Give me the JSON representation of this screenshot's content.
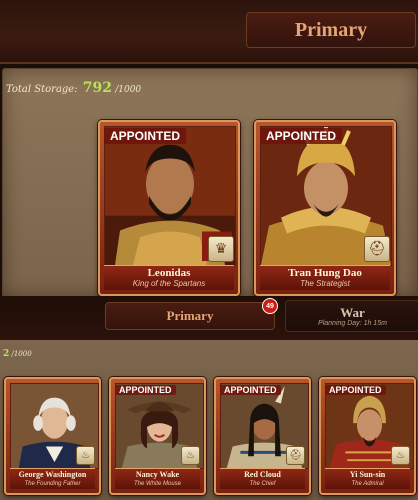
{
  "header": {
    "tab_primary": "Primary"
  },
  "storage": {
    "label": "Total Storage:",
    "current": "792",
    "max": "/1000"
  },
  "appointed_label": "APPOINTED",
  "top_generals": [
    {
      "name": "Leonidas",
      "title": "King of the Spartans",
      "emblem": "crown-icon",
      "appointed": true
    },
    {
      "name": "Tran Hung Dao",
      "title": "The Strategist",
      "emblem": "helmet-icon",
      "appointed": true
    }
  ],
  "mid": {
    "tab_primary": "Primary",
    "badge": "49",
    "tab_war": "War",
    "war_sub": "Planning Day: 1h 15m"
  },
  "storage2": {
    "current": "2",
    "max": "/1000"
  },
  "bottom_generals": [
    {
      "name": "George Washington",
      "title": "The Founding Father",
      "emblem": "flame-icon",
      "appointed": false
    },
    {
      "name": "Nancy Wake",
      "title": "The White Mouse",
      "emblem": "flame-icon",
      "appointed": true
    },
    {
      "name": "Red Cloud",
      "title": "The Chief",
      "emblem": "helmet-icon",
      "appointed": true
    },
    {
      "name": "Yi Sun-sin",
      "title": "The Admiral",
      "emblem": "flame-icon",
      "appointed": true
    }
  ]
}
